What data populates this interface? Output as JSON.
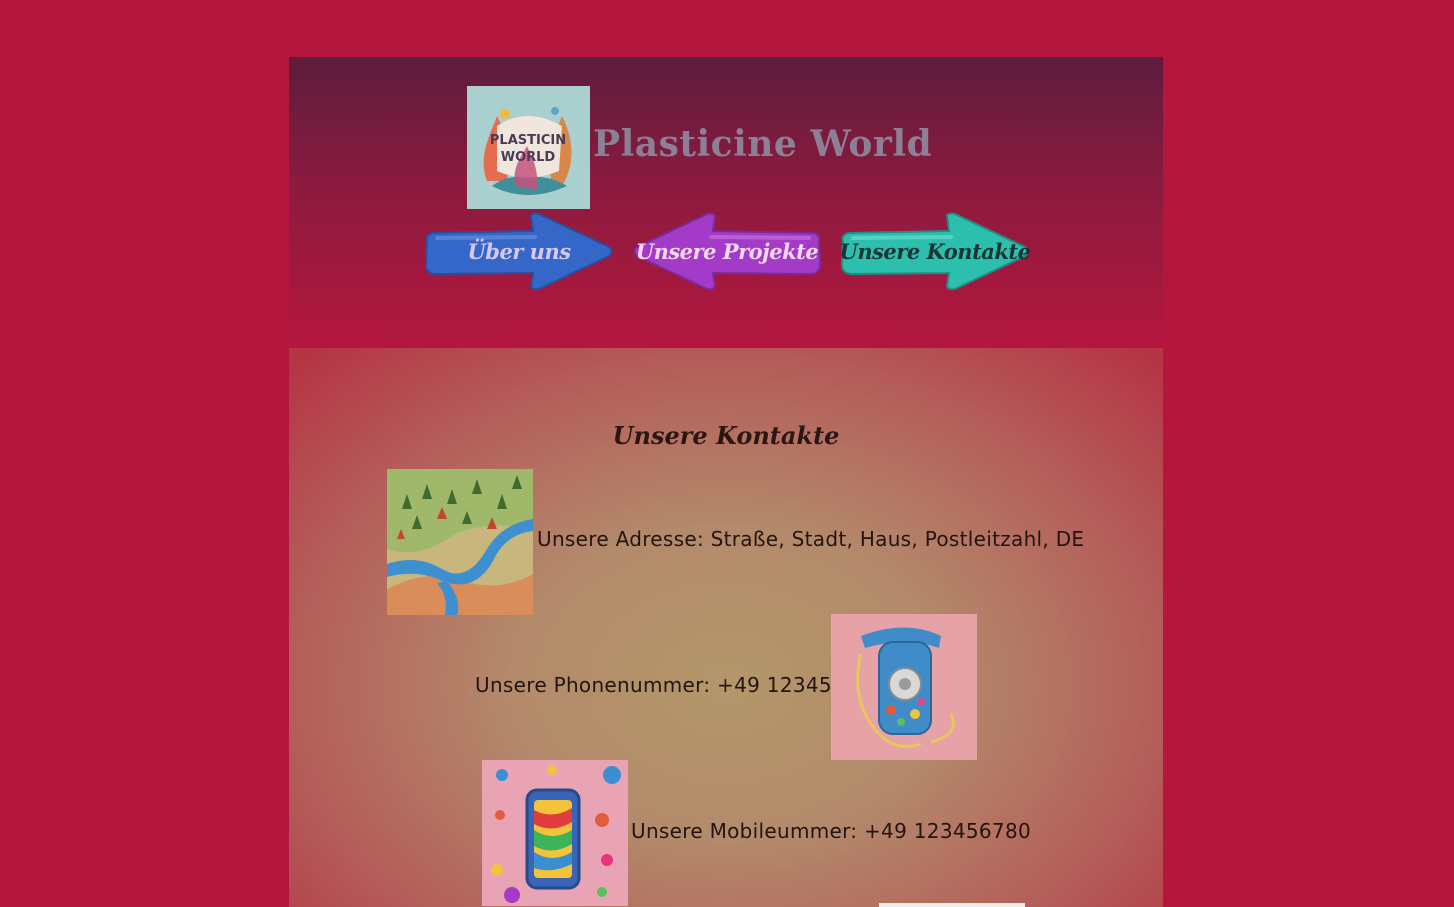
{
  "header": {
    "logo_text_line1": "PLASTICIN",
    "logo_text_line2": "WORLD",
    "site_title": "Plasticine World"
  },
  "nav": [
    {
      "label": "Über uns",
      "color": "#3567c8",
      "direction": "right"
    },
    {
      "label": "Unsere Projekte",
      "color": "#a43bc8",
      "direction": "left"
    },
    {
      "label": "Unsere Kontakte",
      "color": "#2cbfae",
      "direction": "right"
    }
  ],
  "content": {
    "title": "Unsere Kontakte",
    "address": "Unsere Adresse: Straße, Stadt, Haus, Postleitzahl, DE",
    "phone": "Unsere Phonenummer: +49 123456789",
    "mobile": "Unsere Mobileummer: +49 123456780"
  },
  "colors": {
    "page_background": "#b5163e",
    "title_color": "#8d7f96"
  }
}
